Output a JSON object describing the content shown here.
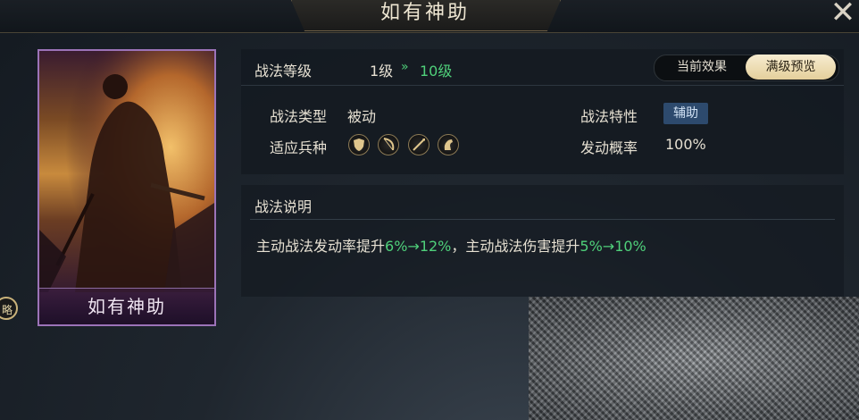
{
  "header": {
    "title": "如有神助",
    "close_icon": "close-icon"
  },
  "card": {
    "name": "如有神助",
    "art_icon": "general-portrait",
    "border_color": "#9c73b8"
  },
  "side_tab": {
    "label": "略"
  },
  "level": {
    "label": "战法等级",
    "current": "1级",
    "arrow": "»",
    "max": "10级"
  },
  "toggle": {
    "off_label": "当前效果",
    "on_label": "满级预览",
    "selected": "满级预览"
  },
  "info": {
    "type_label": "战法类型",
    "type_value": "被动",
    "trait_label": "战法特性",
    "trait_value": "辅助",
    "troop_label": "适应兵种",
    "troops": [
      {
        "icon": "shield-icon"
      },
      {
        "icon": "bow-icon"
      },
      {
        "icon": "spear-icon"
      },
      {
        "icon": "horse-icon"
      }
    ],
    "rate_label": "发动概率",
    "rate_value": "100%"
  },
  "description": {
    "heading": "战法说明",
    "part1": "主动战法发动率提升",
    "v1a": "6%",
    "arrow1": "→",
    "v1b": "12%",
    "part2": "，主动战法伤害提升",
    "v2a": "5%",
    "arrow2": "→",
    "v2b": "10%"
  },
  "colors": {
    "accent_green": "#4fd07a",
    "gold": "#e4cf9b",
    "trait_blue": "#2d4a6d"
  }
}
